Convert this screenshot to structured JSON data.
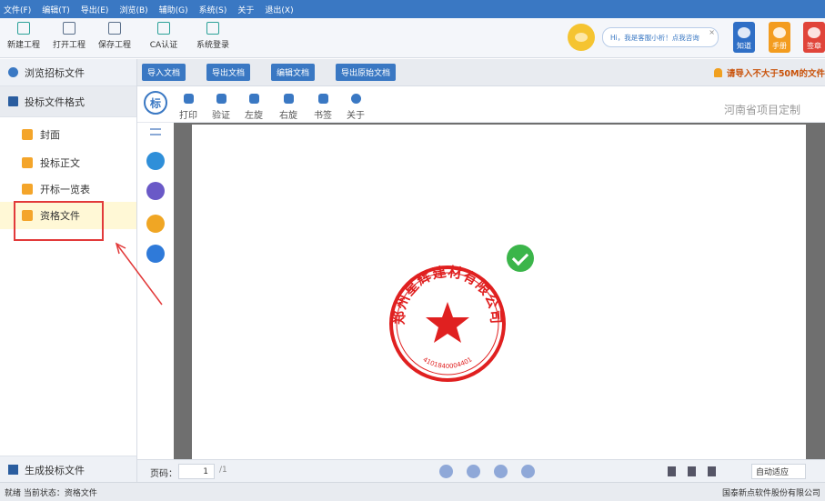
{
  "menu": [
    "文件(F)",
    "编辑(T)",
    "导出(E)",
    "浏览(B)",
    "辅助(G)",
    "系统(S)",
    "关于",
    "退出(X)"
  ],
  "toolbar": {
    "new_project": "新建工程",
    "open_project": "打开工程",
    "save_project": "保存工程",
    "ca_auth": "CA认证",
    "system_login": "系统登录"
  },
  "assistant": {
    "greeting": "Hi，我是客服小析！点我咨询",
    "close": "×"
  },
  "badges": {
    "zhidao": "知道",
    "shouce": "手册",
    "qianzhang": "签章"
  },
  "left": {
    "browse_tender": "浏览招标文件",
    "format_header": "投标文件格式",
    "items": [
      "封面",
      "投标正文",
      "开标一览表",
      "资格文件"
    ],
    "generate": "生成投标文件"
  },
  "actions": {
    "import_doc": "导入文档",
    "export_doc": "导出文档",
    "edit_doc": "编辑文档",
    "export_original": "导出原始文档",
    "warning": "请导入不大于50M的文件"
  },
  "viewer": {
    "logo": "标",
    "print": "打印",
    "verify": "验证",
    "rotate_left": "左旋",
    "rotate_right": "右旋",
    "bookmark": "书签",
    "about": "关于",
    "region": "河南省项目定制"
  },
  "seal": {
    "name": "郑州星辉建材有限公司",
    "number": "4101840004401"
  },
  "pagenav": {
    "label": "页码：",
    "page": "1",
    "total": "/1",
    "zoom": "自动适应"
  },
  "status": {
    "text": "就绪  当前状态：资格文件",
    "company": "国泰新点软件股份有限公司"
  },
  "colors": {
    "menubar": "#3a78c3",
    "accent": "#3a78c3",
    "highlight": "#e23a3a",
    "seal": "#e02020",
    "check": "#3bb54a"
  }
}
